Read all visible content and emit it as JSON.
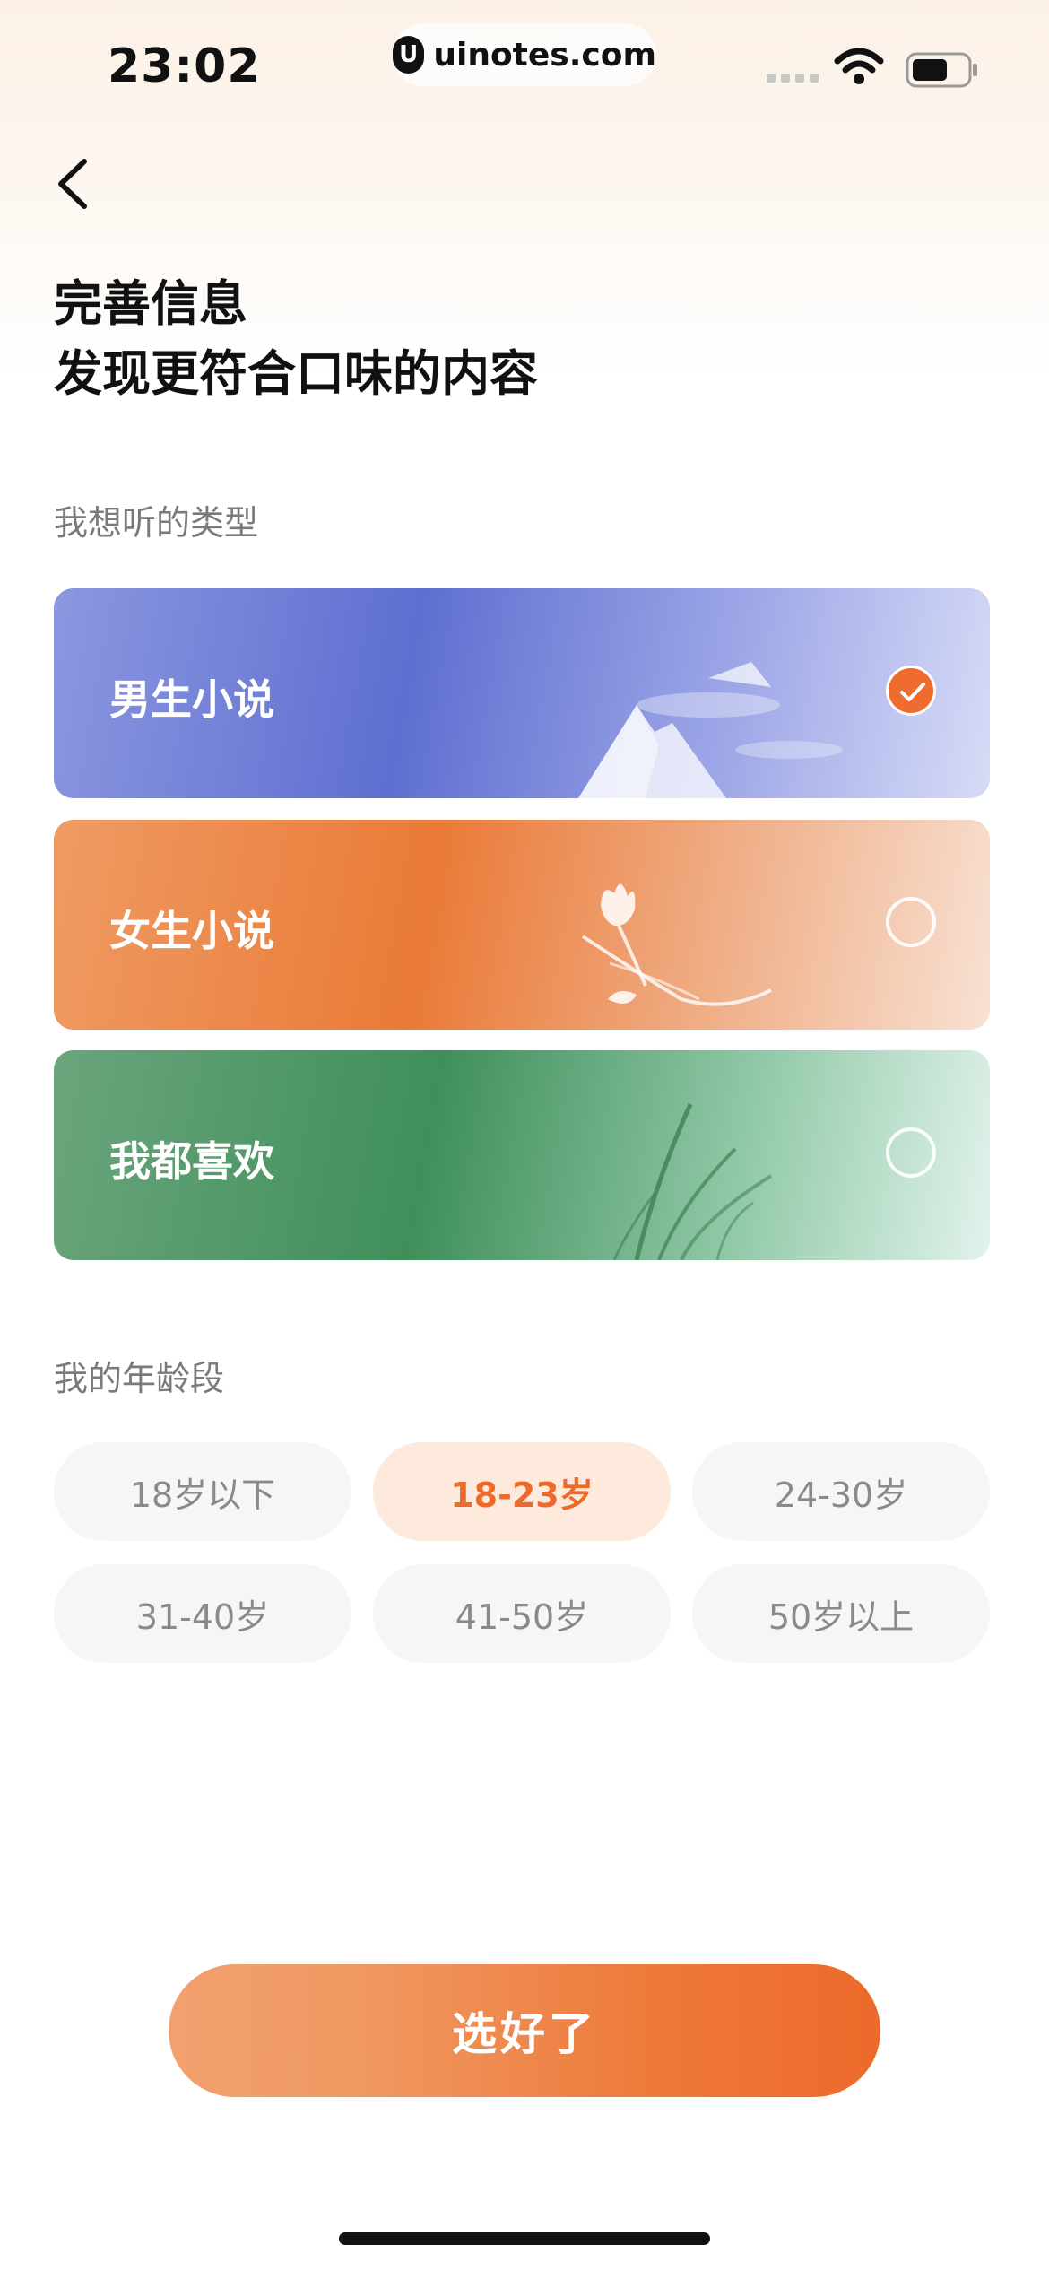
{
  "status_bar": {
    "time": "23:02",
    "url": "uinotes.com",
    "url_logo_glyph": "U"
  },
  "header": {
    "back_icon": "chevron-left-icon",
    "title_line1": "完善信息",
    "title_line2": "发现更符合口味的内容"
  },
  "genre_section": {
    "label": "我想听的类型",
    "options": [
      {
        "label": "男生小说",
        "selected": true,
        "art": "mountain-illustration",
        "color": "#5f6fd0"
      },
      {
        "label": "女生小说",
        "selected": false,
        "art": "tulip-illustration",
        "color": "#ea7a37"
      },
      {
        "label": "我都喜欢",
        "selected": false,
        "art": "grass-illustration",
        "color": "#3f8f5b"
      }
    ]
  },
  "age_section": {
    "label": "我的年龄段",
    "options": [
      {
        "label": "18岁以下",
        "selected": false
      },
      {
        "label": "18-23岁",
        "selected": true
      },
      {
        "label": "24-30岁",
        "selected": false
      },
      {
        "label": "31-40岁",
        "selected": false
      },
      {
        "label": "41-50岁",
        "selected": false
      },
      {
        "label": "50岁以上",
        "selected": false
      }
    ]
  },
  "confirm_button": {
    "label": "选好了"
  },
  "colors": {
    "accent": "#ec6a2b",
    "accent_light": "#fdeadd",
    "pill_bg": "#f6f6f6"
  }
}
